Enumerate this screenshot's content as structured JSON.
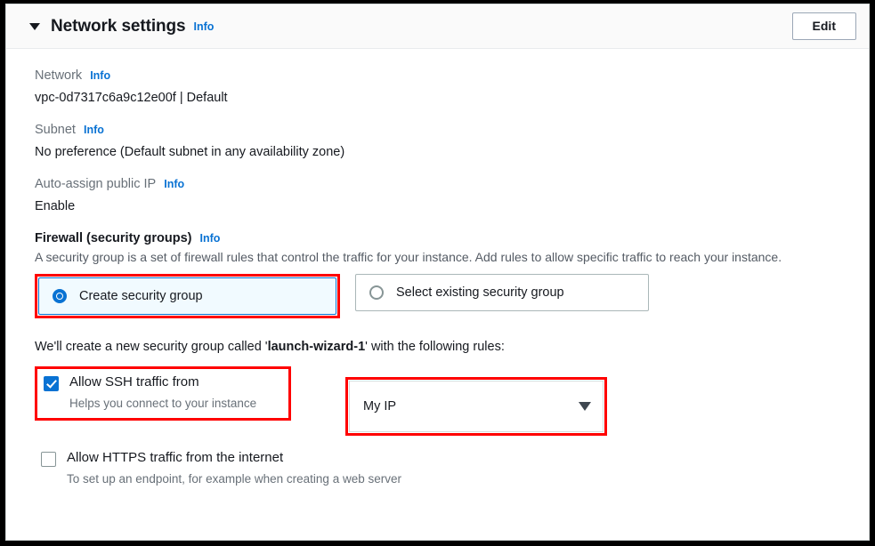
{
  "header": {
    "title": "Network settings",
    "info_label": "Info",
    "edit_label": "Edit",
    "caret_icon": "caret-down-icon"
  },
  "fields": [
    {
      "label": "Network",
      "info_label": "Info",
      "value": "vpc-0d7317c6a9c12e00f | Default"
    },
    {
      "label": "Subnet",
      "info_label": "Info",
      "value": "No preference (Default subnet in any availability zone)"
    },
    {
      "label": "Auto-assign public IP",
      "info_label": "Info",
      "value": "Enable"
    }
  ],
  "firewall": {
    "heading": "Firewall (security groups)",
    "info_label": "Info",
    "description": "A security group is a set of firewall rules that control the traffic for your instance. Add rules to allow specific traffic to reach your instance.",
    "options": [
      {
        "label": "Create security group",
        "selected": true
      },
      {
        "label": "Select existing security group",
        "selected": false
      }
    ],
    "note_prefix": "We'll create a new security group called '",
    "note_name": "launch-wizard-1",
    "note_suffix": "' with the following rules:"
  },
  "rules": {
    "ssh": {
      "label": "Allow SSH traffic from",
      "sublabel": "Helps you connect to your instance",
      "checked": true
    },
    "source_select": {
      "value": "My IP",
      "caret_icon": "caret-down-icon"
    },
    "https": {
      "label": "Allow HTTPS traffic from the internet",
      "sublabel": "To set up an endpoint, for example when creating a web server",
      "checked": false
    }
  },
  "colors": {
    "accent_blue": "#0972d3",
    "annotation_red": "#ff0000",
    "selected_tile_bg": "#f1faff",
    "header_bg": "#fafafa"
  }
}
